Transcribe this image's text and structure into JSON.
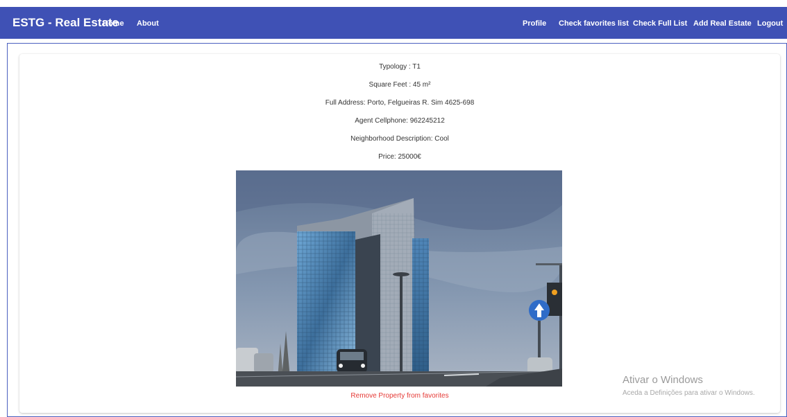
{
  "navbar": {
    "brand": "ESTG - Real Estate",
    "left_links": [
      "Home",
      "About"
    ],
    "right_links": [
      "Profile",
      "Check favorites list",
      "Check Full List",
      "Add Real Estate",
      "Logout"
    ],
    "color": "#3f51b5"
  },
  "property": {
    "typology": "Typology : T1",
    "square_feet": "Square Feet : 45 m²",
    "address": "Full Address: Porto, Felgueiras R. Sim 4625-698",
    "agent_phone": "Agent Cellphone: 962245212",
    "neighborhood": "Neighborhood Description: Cool",
    "price": "Price: 25000€",
    "remove_label": "Remove Property from favorites",
    "remove_color": "#e53935"
  },
  "watermark": {
    "title": "Ativar o Windows",
    "subtitle": "Aceda a Definições para ativar o Windows."
  }
}
